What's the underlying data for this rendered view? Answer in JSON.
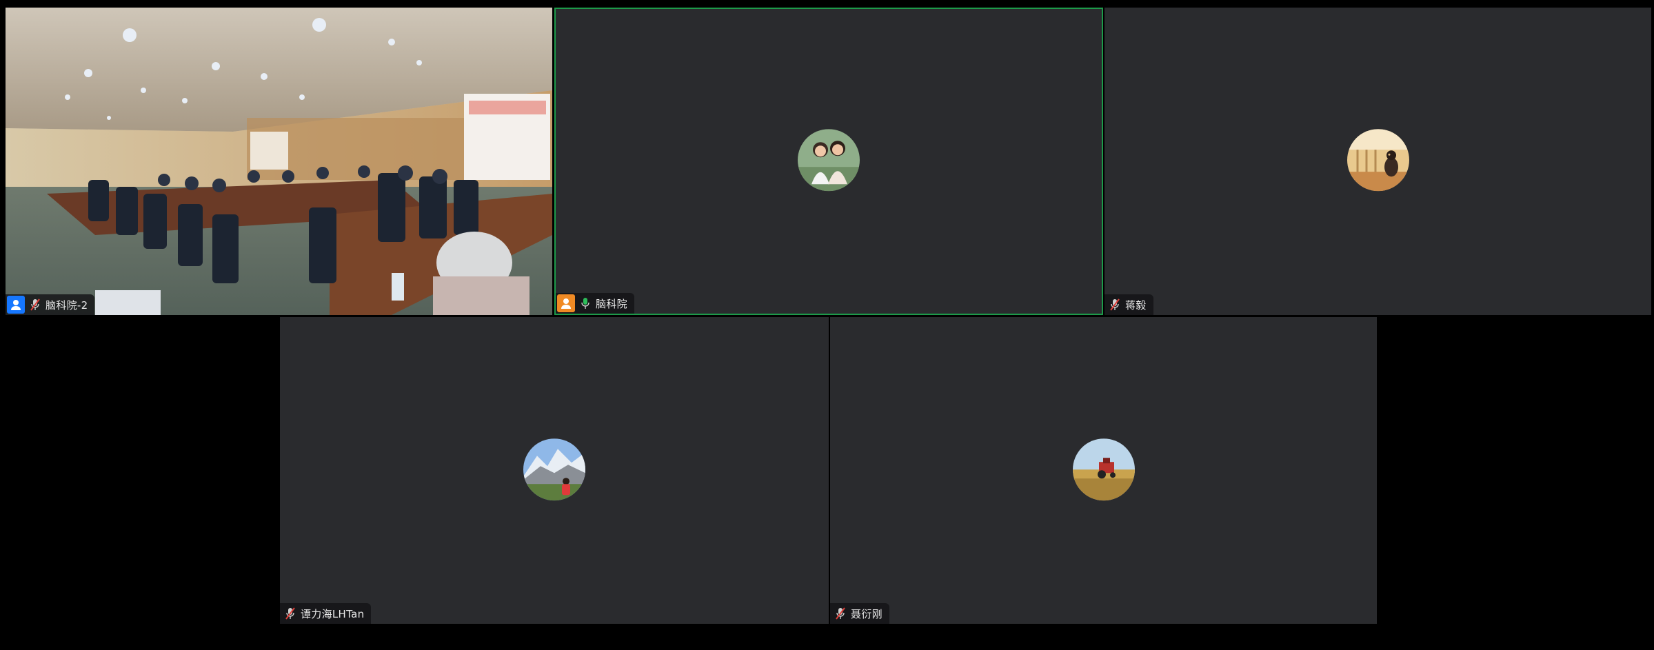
{
  "colors": {
    "stage_bg": "#000000",
    "tile_bg": "#2a2b2e",
    "active_speaker_border": "#1d9a4a",
    "host_blue": "#1677ff",
    "cohost_orange": "#f08a24",
    "mic_muted_red": "#e0413b",
    "mic_active_green": "#2dbd5a"
  },
  "participants": [
    {
      "name": "脑科院-2",
      "role_icon": "person-blue-icon",
      "mic": "muted-mic-icon",
      "video": "on"
    },
    {
      "name": "脑科院",
      "role_icon": "person-orange-icon",
      "mic": "active-mic-icon",
      "video": "off",
      "active_speaker": true
    },
    {
      "name": "蒋毅",
      "mic": "muted-mic-icon",
      "video": "off"
    },
    {
      "name": "谭力海LHTan",
      "mic": "muted-mic-icon",
      "video": "off"
    },
    {
      "name": "聂衍刚",
      "mic": "muted-mic-icon",
      "video": "off"
    }
  ]
}
